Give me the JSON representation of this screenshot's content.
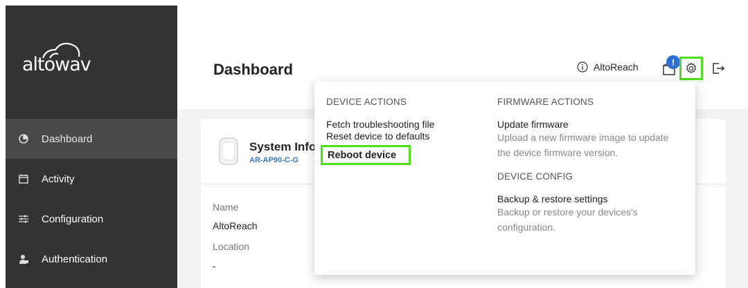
{
  "brand": {
    "logo_text": "altowav"
  },
  "sidebar": {
    "items": [
      {
        "label": "Dashboard",
        "icon": "dashboard-pie-icon",
        "active": true
      },
      {
        "label": "Activity",
        "icon": "calendar-icon",
        "active": false
      },
      {
        "label": "Configuration",
        "icon": "sliders-icon",
        "active": false
      },
      {
        "label": "Authentication",
        "icon": "user-icon",
        "active": false
      }
    ]
  },
  "header": {
    "title": "Dashboard",
    "user_name": "AltoReach",
    "notification_badge": "!"
  },
  "card": {
    "title": "System Info",
    "model": "AR-AP90-C-G",
    "fields": [
      {
        "label": "Name",
        "value": "AltoReach"
      },
      {
        "label": "Location",
        "value": "-"
      }
    ]
  },
  "dropdown": {
    "device_actions": {
      "heading": "DEVICE ACTIONS",
      "items": [
        "Fetch troubleshooting file",
        "Reset device to defaults",
        "Reboot device"
      ]
    },
    "firmware_actions": {
      "heading": "FIRMWARE ACTIONS",
      "item": "Update firmware",
      "description": "Upload a new firmware image to update the device firmware version."
    },
    "device_config": {
      "heading": "DEVICE CONFIG",
      "item": "Backup & restore settings",
      "description": "Backup or restore your devices's configuration."
    }
  },
  "colors": {
    "sidebar_bg": "#333333",
    "sidebar_active": "#4a4a4a",
    "highlight": "#4ce01a",
    "badge": "#2f6fd1",
    "link": "#3a78c9"
  }
}
